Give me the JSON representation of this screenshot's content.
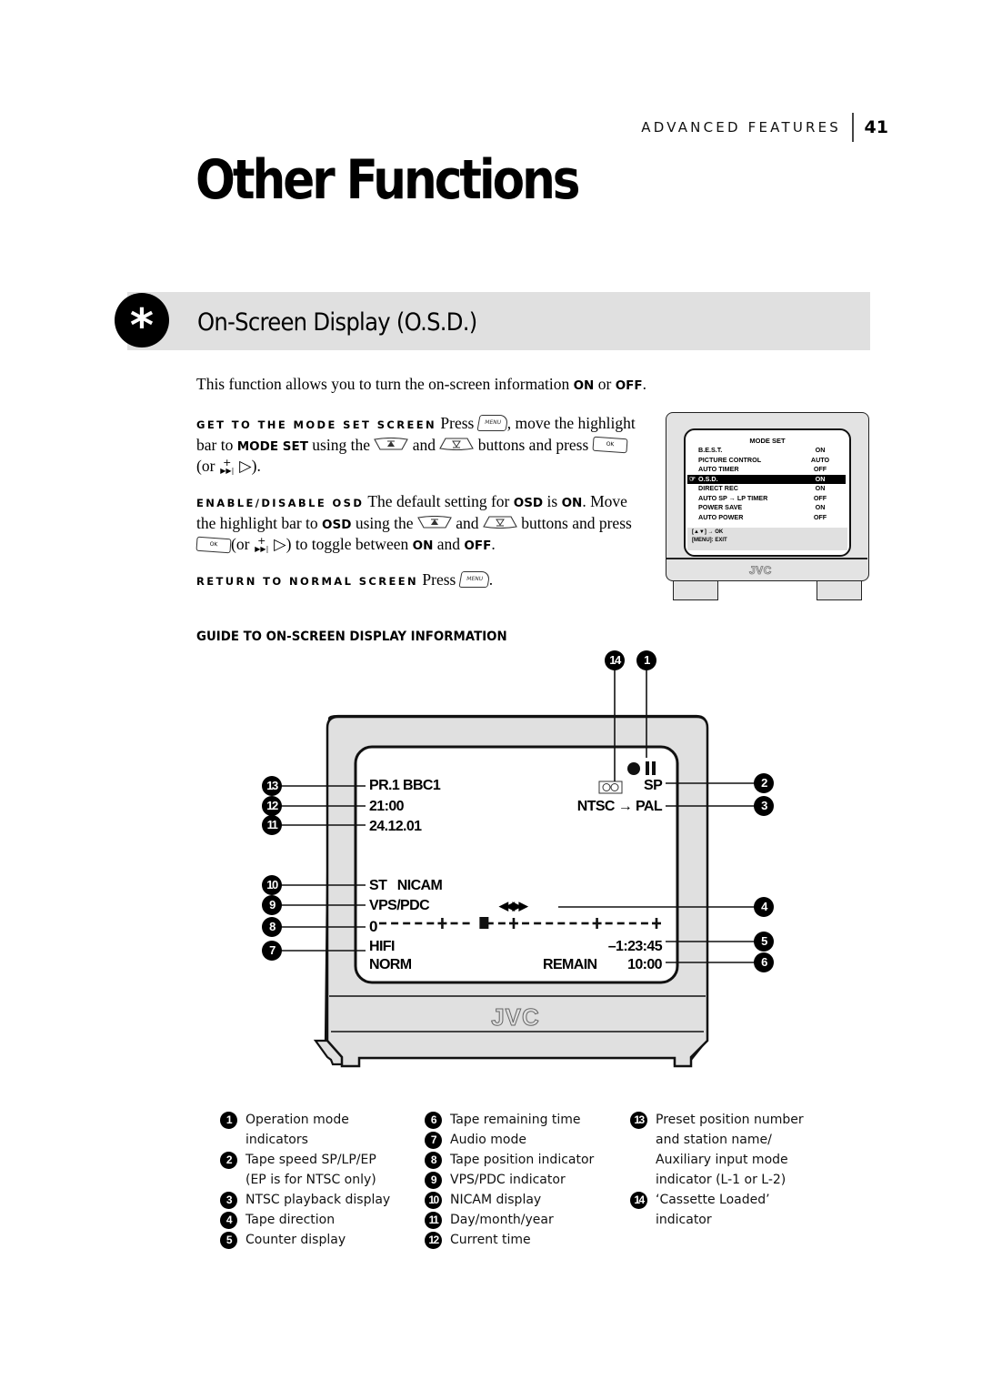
{
  "header": {
    "section": "ADVANCED FEATURES",
    "page_number": "41"
  },
  "title": "Other Functions",
  "section": {
    "icon": "asterisk-icon",
    "title": "On-Screen Display (O.S.D.)"
  },
  "intro": {
    "text_before": "This function allows you to turn the on-screen information ",
    "on": "ON",
    "or": " or ",
    "off": "OFF",
    "end": "."
  },
  "steps": [
    {
      "runin": "GET TO THE MODE SET SCREEN",
      "t1": " Press ",
      "t2": ", move the highlight bar to ",
      "bold1": "MODE SET",
      "t3": " using the ",
      "t4": " and ",
      "t5": " buttons and press ",
      "t6": " (or ",
      "t7": " ▷)."
    },
    {
      "runin": "ENABLE/DISABLE OSD",
      "t1": " The default setting for ",
      "bold1": "OSD",
      "t2": " is ",
      "bold2": "ON",
      "t3": ". Move the highlight bar to ",
      "bold3": "OSD",
      "t4": " using the ",
      "t5": " and ",
      "t6": " buttons and press ",
      "t7": "(or ",
      "t8": " ▷) to toggle between ",
      "bold4": "ON",
      "t9": " and ",
      "bold5": "OFF",
      "t10": "."
    },
    {
      "runin": "RETURN TO NORMAL SCREEN",
      "t1": " Press ",
      "t2": "."
    }
  ],
  "keys": {
    "menu": "MENU",
    "ok": "OK",
    "up": "▲",
    "down": "▼",
    "ffwd_plus": "+",
    "ffwd": "▶▶|"
  },
  "mode_set_screen": {
    "title": "MODE SET",
    "rows": [
      {
        "label": "B.E.S.T.",
        "value": "ON"
      },
      {
        "label": "PICTURE CONTROL",
        "value": "AUTO"
      },
      {
        "label": "AUTO TIMER",
        "value": "OFF"
      },
      {
        "label": "O.S.D.",
        "value": "ON",
        "highlighted": true
      },
      {
        "label": "DIRECT REC",
        "value": "ON"
      },
      {
        "label": "AUTO SP → LP TIMER",
        "value": "OFF"
      },
      {
        "label": "POWER SAVE",
        "value": "ON"
      },
      {
        "label": "AUTO POWER",
        "value": "OFF"
      }
    ],
    "hint_line1": "[▲▼] → OK",
    "hint_line2": "[MENU]: EXIT",
    "brand": "JVC"
  },
  "guide_heading": "GUIDE TO ON-SCREEN DISPLAY INFORMATION",
  "osd_screen": {
    "station": "PR.1  BBC1",
    "time": "21:00",
    "date": "24.12.01",
    "nicam": "ST   NICAM",
    "vps": "VPS/PDC",
    "direction": "◀◀ ▶▶",
    "tape_scale": "0 - - - - - + - - ■ - - + - - - - - - + - - - - +",
    "tape_scale_start": "0",
    "tape_position_fraction": 0.37,
    "audio": "HIFI",
    "norm": "NORM",
    "speed": "SP",
    "system": "NTSC → PAL",
    "counter": "–1:23:45",
    "remain_label": "REMAIN",
    "remain_value": "10:00",
    "brand": "JVC"
  },
  "callouts": {
    "1": "1",
    "2": "2",
    "3": "3",
    "4": "4",
    "5": "5",
    "6": "6",
    "7": "7",
    "8": "8",
    "9": "9",
    "10": "10",
    "11": "11",
    "12": "12",
    "13": "13",
    "14": "14"
  },
  "legend": [
    {
      "num": "1",
      "text": "Operation mode",
      "text2": "indicators"
    },
    {
      "num": "2",
      "text": "Tape speed SP/LP/EP",
      "text2": "(EP is for NTSC only)"
    },
    {
      "num": "3",
      "text": "NTSC playback display"
    },
    {
      "num": "4",
      "text": "Tape direction"
    },
    {
      "num": "5",
      "text": "Counter display"
    },
    {
      "num": "6",
      "text": "Tape remaining time"
    },
    {
      "num": "7",
      "text": "Audio mode"
    },
    {
      "num": "8",
      "text": "Tape position indicator"
    },
    {
      "num": "9",
      "text": "VPS/PDC indicator"
    },
    {
      "num": "10",
      "text": "NICAM display"
    },
    {
      "num": "11",
      "text": "Day/month/year"
    },
    {
      "num": "12",
      "text": "Current time"
    },
    {
      "num": "13",
      "text": "Preset position number",
      "text2": "and station name/",
      "text3": "Auxiliary input mode",
      "text4": "indicator (L-1 or L-2)"
    },
    {
      "num": "14",
      "text": "‘Cassette Loaded’",
      "text2": "indicator"
    }
  ]
}
